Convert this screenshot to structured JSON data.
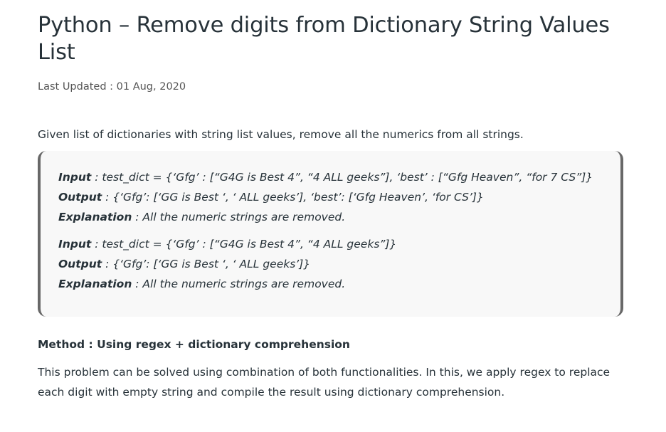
{
  "article": {
    "title": "Python – Remove digits from Dictionary String Values List",
    "last_updated": "Last Updated : 01 Aug, 2020",
    "intro": "Given list of dictionaries with string list values, remove all the numerics from all strings.",
    "examples": [
      {
        "input_label": "Input",
        "input_text": " : test_dict = {‘Gfg’ : [“G4G is Best 4”, “4 ALL geeks”], ‘best’ : [“Gfg Heaven”, “for 7 CS”]}",
        "output_label": "Output",
        "output_text": " : {‘Gfg’: [‘GG is Best ‘, ‘ ALL geeks’], ‘best’: [‘Gfg Heaven’, ‘for CS’]}",
        "explanation_label": "Explanation",
        "explanation_text": " : All the numeric strings are removed."
      },
      {
        "input_label": "Input",
        "input_text": " : test_dict = {‘Gfg’ : [“G4G is Best 4”, “4 ALL geeks”]}",
        "output_label": "Output",
        "output_text": " : {‘Gfg’: [‘GG is Best ‘, ‘ ALL geeks’]}",
        "explanation_label": "Explanation",
        "explanation_text": " : All the numeric strings are removed."
      }
    ],
    "method_heading": "Method : Using regex + dictionary comprehension",
    "method_description": "This problem can be solved using combination of both functionalities. In this, we apply regex to replace each digit with empty string and compile the result using dictionary comprehension."
  }
}
